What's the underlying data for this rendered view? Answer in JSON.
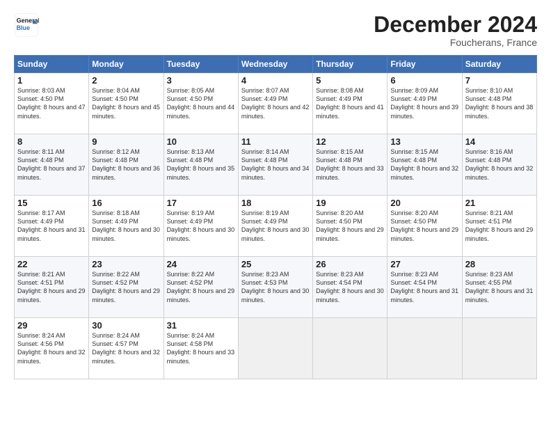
{
  "header": {
    "logo_line1": "General",
    "logo_line2": "Blue",
    "month_title": "December 2024",
    "location": "Foucherans, France"
  },
  "weekdays": [
    "Sunday",
    "Monday",
    "Tuesday",
    "Wednesday",
    "Thursday",
    "Friday",
    "Saturday"
  ],
  "weeks": [
    [
      {
        "day": "1",
        "sunrise": "8:03 AM",
        "sunset": "4:50 PM",
        "daylight": "8 hours and 47 minutes."
      },
      {
        "day": "2",
        "sunrise": "8:04 AM",
        "sunset": "4:50 PM",
        "daylight": "8 hours and 45 minutes."
      },
      {
        "day": "3",
        "sunrise": "8:05 AM",
        "sunset": "4:50 PM",
        "daylight": "8 hours and 44 minutes."
      },
      {
        "day": "4",
        "sunrise": "8:07 AM",
        "sunset": "4:49 PM",
        "daylight": "8 hours and 42 minutes."
      },
      {
        "day": "5",
        "sunrise": "8:08 AM",
        "sunset": "4:49 PM",
        "daylight": "8 hours and 41 minutes."
      },
      {
        "day": "6",
        "sunrise": "8:09 AM",
        "sunset": "4:49 PM",
        "daylight": "8 hours and 39 minutes."
      },
      {
        "day": "7",
        "sunrise": "8:10 AM",
        "sunset": "4:48 PM",
        "daylight": "8 hours and 38 minutes."
      }
    ],
    [
      {
        "day": "8",
        "sunrise": "8:11 AM",
        "sunset": "4:48 PM",
        "daylight": "8 hours and 37 minutes."
      },
      {
        "day": "9",
        "sunrise": "8:12 AM",
        "sunset": "4:48 PM",
        "daylight": "8 hours and 36 minutes."
      },
      {
        "day": "10",
        "sunrise": "8:13 AM",
        "sunset": "4:48 PM",
        "daylight": "8 hours and 35 minutes."
      },
      {
        "day": "11",
        "sunrise": "8:14 AM",
        "sunset": "4:48 PM",
        "daylight": "8 hours and 34 minutes."
      },
      {
        "day": "12",
        "sunrise": "8:15 AM",
        "sunset": "4:48 PM",
        "daylight": "8 hours and 33 minutes."
      },
      {
        "day": "13",
        "sunrise": "8:15 AM",
        "sunset": "4:48 PM",
        "daylight": "8 hours and 32 minutes."
      },
      {
        "day": "14",
        "sunrise": "8:16 AM",
        "sunset": "4:48 PM",
        "daylight": "8 hours and 32 minutes."
      }
    ],
    [
      {
        "day": "15",
        "sunrise": "8:17 AM",
        "sunset": "4:49 PM",
        "daylight": "8 hours and 31 minutes."
      },
      {
        "day": "16",
        "sunrise": "8:18 AM",
        "sunset": "4:49 PM",
        "daylight": "8 hours and 30 minutes."
      },
      {
        "day": "17",
        "sunrise": "8:19 AM",
        "sunset": "4:49 PM",
        "daylight": "8 hours and 30 minutes."
      },
      {
        "day": "18",
        "sunrise": "8:19 AM",
        "sunset": "4:49 PM",
        "daylight": "8 hours and 30 minutes."
      },
      {
        "day": "19",
        "sunrise": "8:20 AM",
        "sunset": "4:50 PM",
        "daylight": "8 hours and 29 minutes."
      },
      {
        "day": "20",
        "sunrise": "8:20 AM",
        "sunset": "4:50 PM",
        "daylight": "8 hours and 29 minutes."
      },
      {
        "day": "21",
        "sunrise": "8:21 AM",
        "sunset": "4:51 PM",
        "daylight": "8 hours and 29 minutes."
      }
    ],
    [
      {
        "day": "22",
        "sunrise": "8:21 AM",
        "sunset": "4:51 PM",
        "daylight": "8 hours and 29 minutes."
      },
      {
        "day": "23",
        "sunrise": "8:22 AM",
        "sunset": "4:52 PM",
        "daylight": "8 hours and 29 minutes."
      },
      {
        "day": "24",
        "sunrise": "8:22 AM",
        "sunset": "4:52 PM",
        "daylight": "8 hours and 29 minutes."
      },
      {
        "day": "25",
        "sunrise": "8:23 AM",
        "sunset": "4:53 PM",
        "daylight": "8 hours and 30 minutes."
      },
      {
        "day": "26",
        "sunrise": "8:23 AM",
        "sunset": "4:54 PM",
        "daylight": "8 hours and 30 minutes."
      },
      {
        "day": "27",
        "sunrise": "8:23 AM",
        "sunset": "4:54 PM",
        "daylight": "8 hours and 31 minutes."
      },
      {
        "day": "28",
        "sunrise": "8:23 AM",
        "sunset": "4:55 PM",
        "daylight": "8 hours and 31 minutes."
      }
    ],
    [
      {
        "day": "29",
        "sunrise": "8:24 AM",
        "sunset": "4:56 PM",
        "daylight": "8 hours and 32 minutes."
      },
      {
        "day": "30",
        "sunrise": "8:24 AM",
        "sunset": "4:57 PM",
        "daylight": "8 hours and 32 minutes."
      },
      {
        "day": "31",
        "sunrise": "8:24 AM",
        "sunset": "4:58 PM",
        "daylight": "8 hours and 33 minutes."
      },
      null,
      null,
      null,
      null
    ]
  ],
  "labels": {
    "sunrise": "Sunrise:",
    "sunset": "Sunset:",
    "daylight": "Daylight:"
  }
}
